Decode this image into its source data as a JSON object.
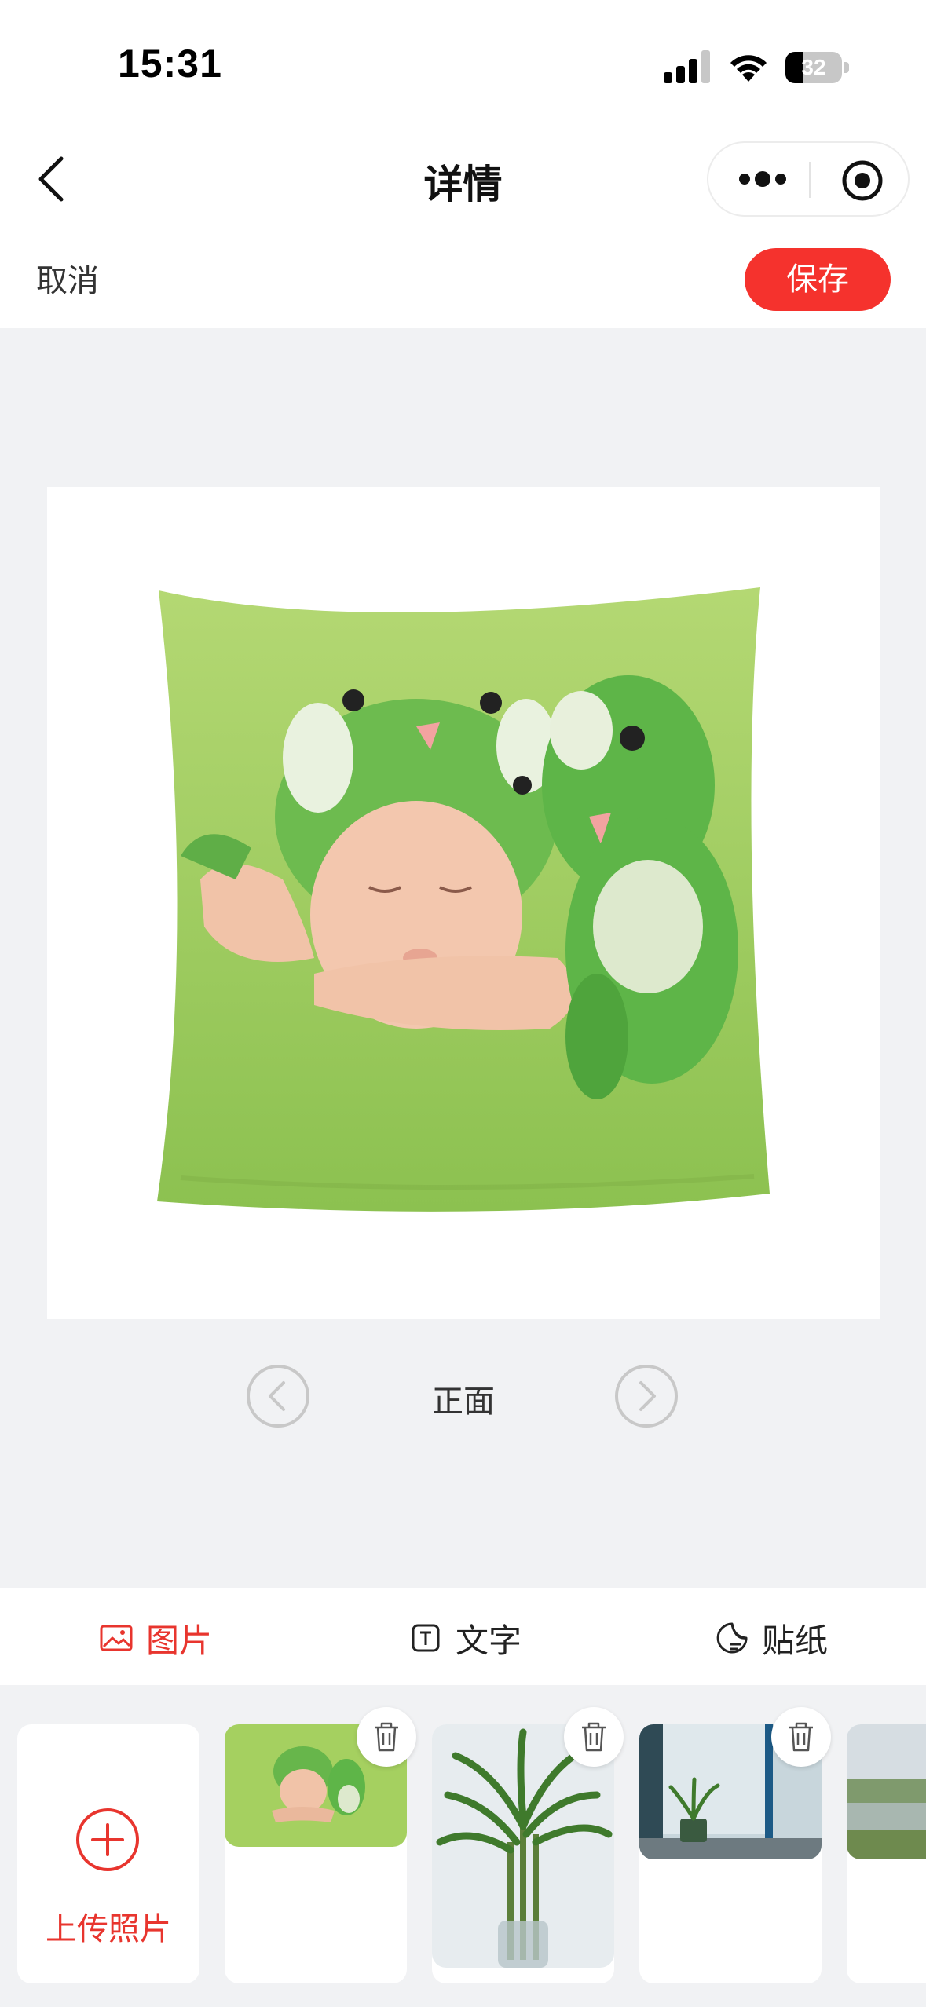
{
  "status_bar": {
    "time": "15:31",
    "battery": "32",
    "battery_level": 0.32
  },
  "nav": {
    "title": "详情"
  },
  "action_bar": {
    "cancel_label": "取消",
    "save_label": "保存"
  },
  "preview": {
    "side_label": "正面"
  },
  "tabs": [
    {
      "label": "图片",
      "icon": "image-icon",
      "active": true
    },
    {
      "label": "文字",
      "icon": "text-icon",
      "active": false
    },
    {
      "label": "贴纸",
      "icon": "sticker-icon",
      "active": false
    }
  ],
  "uploads": {
    "upload_label": "上传照片",
    "photos": [
      {
        "icon": "baby-dinosaur-photo"
      },
      {
        "icon": "bamboo-plant-photo"
      },
      {
        "icon": "window-plant-photo"
      },
      {
        "icon": "lake-landscape-photo"
      }
    ]
  },
  "colors": {
    "accent": "#f5322d",
    "tab_active": "#e8352e",
    "pillow_green": "#9dc95e",
    "background": "#f1f2f4"
  }
}
